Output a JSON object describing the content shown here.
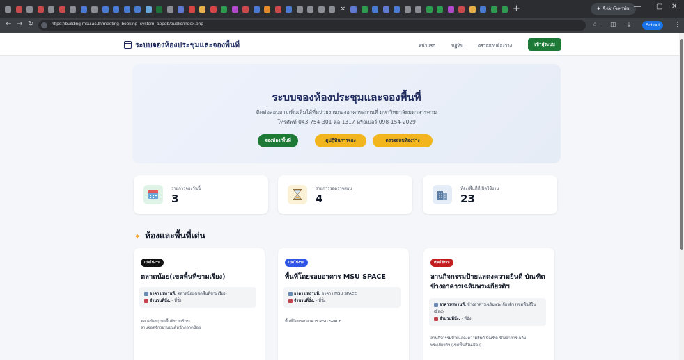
{
  "browser": {
    "url": "https://building.msu.ac.th/meeting_booking_system_appdb/public/index.php",
    "gemini_label": "Ask Gemini",
    "profile_label": "School"
  },
  "nav": {
    "brand": "ระบบจองห้องประชุมและจองพื้นที่",
    "links": [
      "หน้าแรก",
      "ปฏิทิน",
      "ตรวจสอบห้องว่าง"
    ],
    "login": "เข้าสู่ระบบ"
  },
  "hero": {
    "title": "ระบบจองห้องประชุมและจองพื้นที่",
    "line1": "ติดต่อสอบถามเพิ่มเติมได้ที่หน่วยงานกองอาคารสถานที่ มหาวิทยาลัยมหาสารคาม",
    "line2": "โทรศัพท์ 043-754-301 ต่อ 1317 หรือเบอร์ 098-154-2029",
    "buttons": [
      "จองห้อง/พื้นที่",
      "ดูปฏิทินการจอง",
      "ตรวจสอบห้องว่าง"
    ]
  },
  "stats": [
    {
      "label": "รายการจองวันนี้",
      "value": "3",
      "icon": "calendar-icon"
    },
    {
      "label": "รายการรอตรวจสอบ",
      "value": "4",
      "icon": "hourglass-icon"
    },
    {
      "label": "ห้อง/พื้นที่ที่เปิดใช้งาน",
      "value": "23",
      "icon": "building-icon"
    }
  ],
  "section": {
    "title": "ห้องและพื้นที่เด่น"
  },
  "cards": [
    {
      "badge": "เปิดใช้งาน",
      "title": "ตลาดน้อย(เขตพื้นที่ขามเรียง)",
      "building_label": "อาคาร/สถานที่:",
      "building": "ตลาดน้อย(เขตพื้นที่ขามเรียง)",
      "capacity_label": "จำนวนที่นั่ง:",
      "capacity": "- ที่นั่ง",
      "desc1": "ตลาดน้อย(เขตพื้นที่ขามเรียง)",
      "desc2": "ลานจอดจักรยานยนต์หน้าตลาดน้อย"
    },
    {
      "badge": "เปิดใช้งาน",
      "title": "พื้นที่โดยรอบอาคาร MSU SPACE",
      "building_label": "อาคาร/สถานที่:",
      "building": "อาคาร MSU SPACE",
      "capacity_label": "จำนวนที่นั่ง:",
      "capacity": "- ที่นั่ง",
      "desc1": "พื้นที่โดยรอบอาคาร MSU SPACE",
      "desc2": ""
    },
    {
      "badge": "เปิดใช้งาน",
      "title": "ลานกิจกรรมป้ายแสดงความยินดี บัณฑิต ข้างอาคารเฉลิมพระเกียรติฯ",
      "building_label": "อาคาร/สถานที่:",
      "building": "ข้างอาคารเฉลิมพระเกียรติฯ (เขตพื้นที่ในเมือง)",
      "capacity_label": "จำนวนที่นั่ง:",
      "capacity": "- ที่นั่ง",
      "desc1": "ลานกิจกรรมป้ายแสดงความยินดี บัณฑิต ข้างอาคารเฉลิม",
      "desc2": "พระเกียรติฯ (เขตพื้นที่ในเมือง)"
    }
  ],
  "colors": {
    "primary_navy": "#1e2a5e",
    "green": "#1c7a36",
    "yellow": "#f3b51d",
    "badge_black": "#111111",
    "badge_blue": "#2f56e6",
    "badge_red": "#c41e1e"
  }
}
